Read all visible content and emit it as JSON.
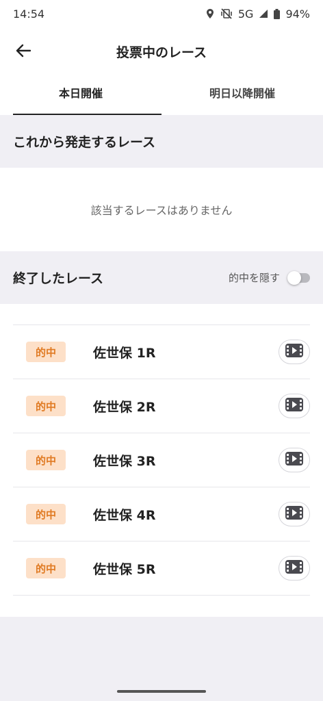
{
  "status_bar": {
    "time": "14:54",
    "network": "5G",
    "battery": "94%",
    "icons": [
      "location-icon",
      "mute-vibrate-icon",
      "signal-icon",
      "battery-icon"
    ]
  },
  "header": {
    "title": "投票中のレース",
    "back_icon": "arrow-left-icon"
  },
  "tabs": [
    {
      "label": "本日開催",
      "active": true
    },
    {
      "label": "明日以降開催",
      "active": false
    }
  ],
  "upcoming": {
    "title": "これから発走するレース",
    "empty_message": "該当するレースはありません"
  },
  "finished": {
    "title": "終了したレース",
    "hide_hits_label": "的中を隠す",
    "hide_hits_on": false,
    "races": [
      {
        "badge": "的中",
        "name": "佐世保 1R"
      },
      {
        "badge": "的中",
        "name": "佐世保 2R"
      },
      {
        "badge": "的中",
        "name": "佐世保 3R"
      },
      {
        "badge": "的中",
        "name": "佐世保 4R"
      },
      {
        "badge": "的中",
        "name": "佐世保 5R"
      }
    ]
  },
  "colors": {
    "badge_bg": "#fde0c8",
    "badge_text": "#e07a22",
    "section_bg": "#f0eff4"
  }
}
